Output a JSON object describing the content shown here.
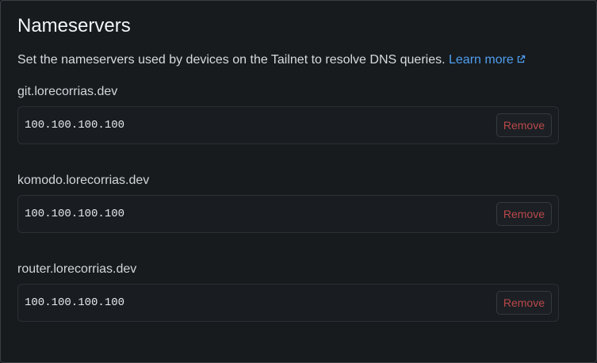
{
  "section": {
    "title": "Nameservers",
    "description": "Set the nameservers used by devices on the Tailnet to resolve DNS queries.",
    "learn_more": "Learn more"
  },
  "nameservers": [
    {
      "domain": "git.lorecorrias.dev",
      "address": "100.100.100.100",
      "remove_label": "Remove"
    },
    {
      "domain": "komodo.lorecorrias.dev",
      "address": "100.100.100.100",
      "remove_label": "Remove"
    },
    {
      "domain": "router.lorecorrias.dev",
      "address": "100.100.100.100",
      "remove_label": "Remove"
    }
  ],
  "colors": {
    "background": "#171b1e",
    "link": "#4f9ef0",
    "danger": "#b9474a"
  },
  "icons": {
    "external_link": "external-link-icon"
  }
}
